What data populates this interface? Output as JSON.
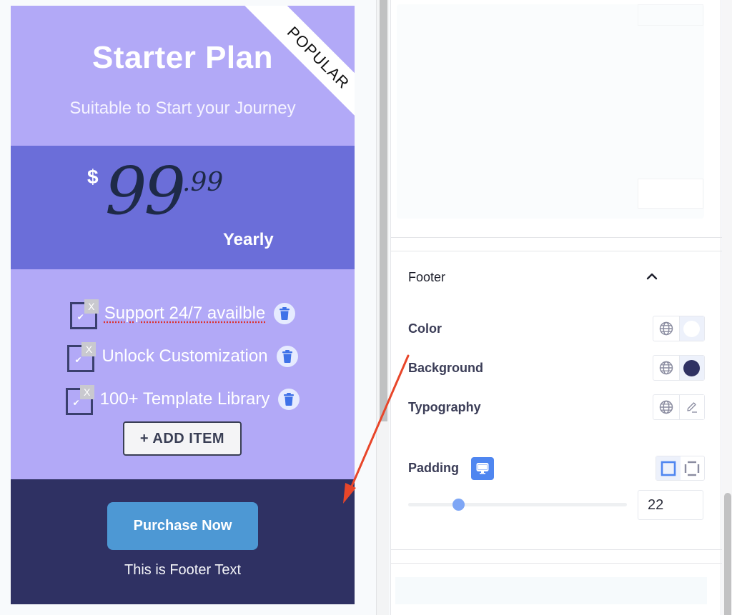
{
  "card": {
    "title": "Starter Plan",
    "subtitle": "Suitable to Start your Journey",
    "ribbon": "POPULAR",
    "currency": "$",
    "price_main": "99",
    "price_cents": ".99",
    "period": "Yearly",
    "features": [
      {
        "label": "Support 24/7 availble",
        "icon": "check-icon",
        "remove_icon": "close-icon",
        "delete_icon": "trash-icon",
        "misspelled": true
      },
      {
        "label": "Unlock Customization",
        "icon": "check-icon",
        "remove_icon": "close-icon",
        "delete_icon": "trash-icon",
        "misspelled": false
      },
      {
        "label": "100+ Template Library",
        "icon": "check-icon",
        "remove_icon": "close-icon",
        "delete_icon": "trash-icon",
        "misspelled": false
      }
    ],
    "feature_tag_glyph": "X",
    "add_item_label": "+ ADD ITEM",
    "purchase_label": "Purchase Now",
    "footer_text": "This is Footer Text",
    "colors": {
      "header_bg": "#b2a9f7",
      "price_bg": "#6b6ed9",
      "footer_bg": "#2f3163",
      "button_bg": "#4d98d4"
    }
  },
  "panel": {
    "section_title": "Footer",
    "collapse_icon": "chevron-up-icon",
    "rows": [
      {
        "label": "Color",
        "global_icon": "globe-icon",
        "value_color": "#ffffff"
      },
      {
        "label": "Background",
        "global_icon": "globe-icon",
        "value_color": "#2f3163"
      },
      {
        "label": "Typography",
        "global_icon": "globe-icon",
        "edit_icon": "pencil-icon"
      }
    ],
    "padding": {
      "label": "Padding",
      "device_icon": "desktop-icon",
      "modes": [
        "linked-square-icon",
        "unlinked-corners-icon"
      ],
      "active_mode": 0,
      "value": "22",
      "slider_fraction": 0.23
    },
    "accent_color": "#4f86f0"
  },
  "annotation": {
    "type": "arrow",
    "color": "#e8462a"
  }
}
